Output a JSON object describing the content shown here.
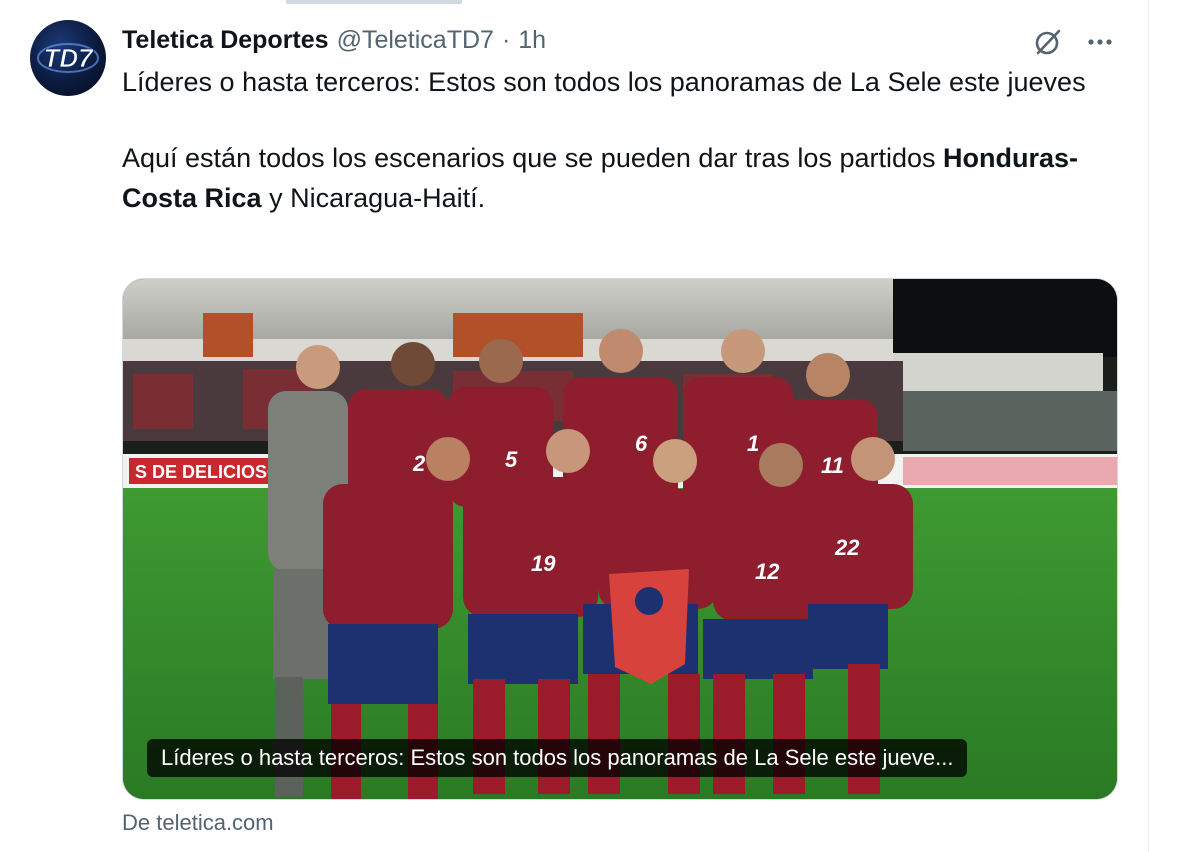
{
  "tweet": {
    "display_name": "Teletica Deportes",
    "handle": "@TeleticaTD7",
    "separator": "·",
    "time": "1h",
    "avatar_text": "TD7",
    "text_line1": "Líderes o hasta terceros: Estos son todos los panoramas de La Sele este jueves",
    "text_line2_a": "Aquí están todos los escenarios que se pueden dar tras los partidos",
    "text_line2_bold": "Honduras-Costa Rica",
    "text_line2_b": " y Nicaragua-Haití."
  },
  "card": {
    "caption": "Líderes o hasta terceros: Estos son todos los panoramas de La Sele este jueve...",
    "source": "De teletica.com",
    "banner_text": "S DE DELICIOSO",
    "jersey_numbers": [
      "2",
      "5",
      "6",
      "1",
      "11",
      "19",
      "12",
      "22"
    ]
  },
  "icons": {
    "grok": "grok-icon",
    "more": "more-icon"
  },
  "colors": {
    "text": "#0f1419",
    "secondary": "#536471",
    "jersey": "#8e1d2e",
    "shorts": "#1d3170",
    "grass": "#2f8a2a"
  }
}
